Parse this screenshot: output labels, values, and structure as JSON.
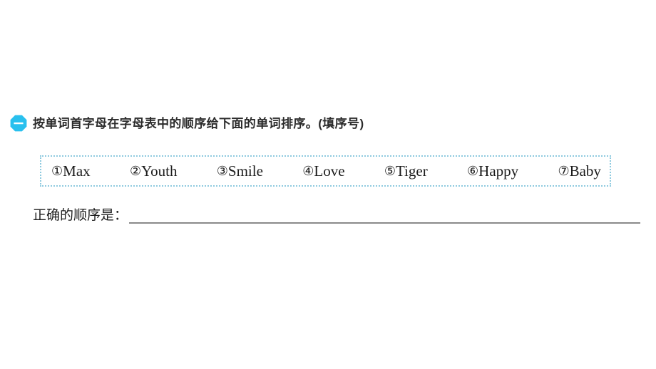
{
  "page": {
    "background_color": "#ffffff",
    "accent_color": "#29c0ee",
    "border_color": "#8ecadf",
    "text_color": "#1c1c1c",
    "rule_color": "#8a8a8a"
  },
  "exercise": {
    "marker": {
      "icon": "octagon-number-one-icon",
      "label": "一",
      "fill": "#29c0ee"
    },
    "title": "按单词首字母在字母表中的顺序给下面的单词排序。(填序号)",
    "word_bank": {
      "words": [
        {
          "num": "①",
          "text": "Max"
        },
        {
          "num": "②",
          "text": "Youth"
        },
        {
          "num": "③",
          "text": "Smile"
        },
        {
          "num": "④",
          "text": "Love"
        },
        {
          "num": "⑤",
          "text": "Tiger"
        },
        {
          "num": "⑥",
          "text": "Happy"
        },
        {
          "num": "⑦",
          "text": "Baby"
        }
      ]
    },
    "answer": {
      "label": "正确的顺序是：",
      "value": ""
    }
  }
}
